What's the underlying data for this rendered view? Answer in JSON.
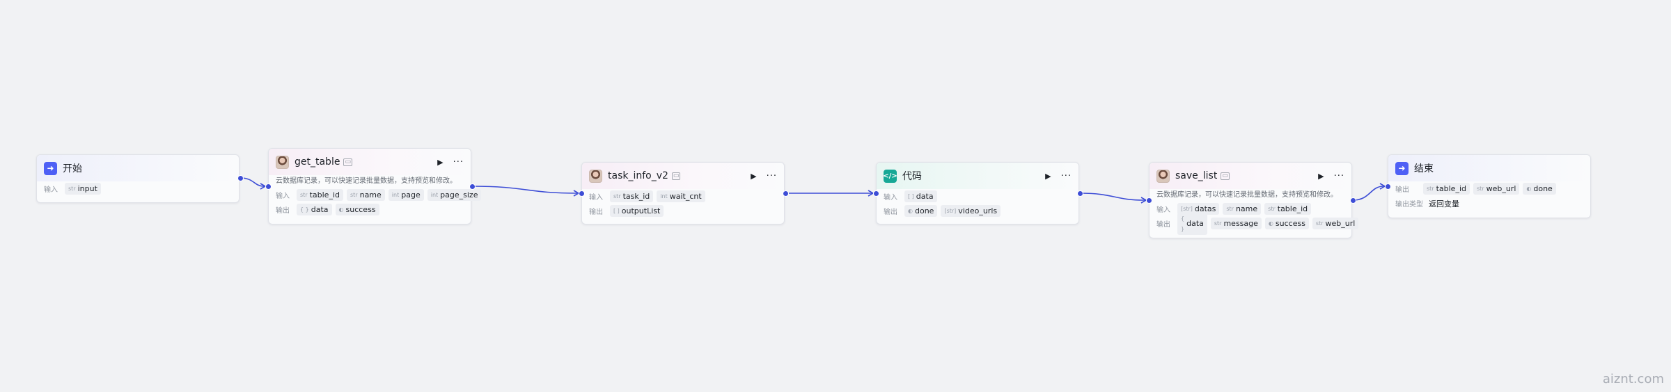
{
  "labels": {
    "input": "输入",
    "output": "输出",
    "output_type": "输出类型"
  },
  "nodes": {
    "start": {
      "title": "开始",
      "inputs": [
        {
          "type": "str",
          "name": "input"
        }
      ]
    },
    "get_table": {
      "title": "get_table",
      "desc": "云数据库记录，可以快速记录批量数据，支持预览和修改。",
      "inputs": [
        {
          "type": "str",
          "name": "table_id"
        },
        {
          "type": "str",
          "name": "name"
        },
        {
          "type": "int",
          "name": "page"
        },
        {
          "type": "int",
          "name": "page_size"
        }
      ],
      "outputs": [
        {
          "type": "{ }",
          "name": "data"
        },
        {
          "type": "◐",
          "name": "success"
        }
      ]
    },
    "task_info_v2": {
      "title": "task_info_v2",
      "inputs": [
        {
          "type": "str",
          "name": "task_id"
        },
        {
          "type": "int",
          "name": "wait_cnt"
        }
      ],
      "outputs": [
        {
          "type": "[ ]",
          "name": "outputList"
        }
      ]
    },
    "code": {
      "title": "代码",
      "inputs": [
        {
          "type": "[ ]",
          "name": "data"
        }
      ],
      "outputs": [
        {
          "type": "◐",
          "name": "done"
        },
        {
          "type": "[str]",
          "name": "video_urls"
        }
      ]
    },
    "save_list": {
      "title": "save_list",
      "desc": "云数据库记录，可以快速记录批量数据，支持预览和修改。",
      "inputs": [
        {
          "type": "[str]",
          "name": "datas"
        },
        {
          "type": "str",
          "name": "name"
        },
        {
          "type": "str",
          "name": "table_id"
        }
      ],
      "outputs": [
        {
          "type": "{ }",
          "name": "data"
        },
        {
          "type": "str",
          "name": "message"
        },
        {
          "type": "◐",
          "name": "success"
        },
        {
          "type": "str",
          "name": "web_url"
        }
      ]
    },
    "end": {
      "title": "结束",
      "outputs": [
        {
          "type": "str",
          "name": "table_id"
        },
        {
          "type": "str",
          "name": "web_url"
        },
        {
          "type": "◐",
          "name": "done"
        }
      ],
      "output_type_value": "返回变量"
    }
  },
  "watermark": "aiznt.com",
  "colors": {
    "accent": "#3d4dd6",
    "canvas": "#f1f2f4"
  },
  "icons": {
    "start": "enter-arrow-icon",
    "end": "exit-arrow-icon",
    "code": "code-brackets-icon",
    "plugin": "plugin-avatar-icon",
    "run": "play-icon",
    "more": "more-dots-icon"
  }
}
